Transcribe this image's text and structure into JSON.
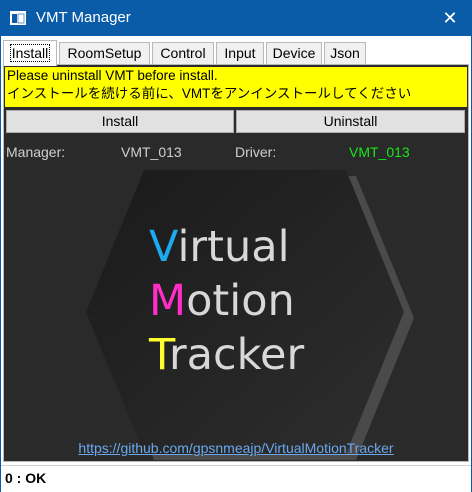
{
  "window": {
    "title": "VMT Manager",
    "close_glyph": "✕"
  },
  "tabs": [
    {
      "label": "Install"
    },
    {
      "label": "RoomSetup"
    },
    {
      "label": "Control"
    },
    {
      "label": "Input"
    },
    {
      "label": "Device"
    },
    {
      "label": "Json"
    }
  ],
  "install": {
    "warning_line1": "Please uninstall VMT before install.",
    "warning_line2": "インストールを続ける前に、VMTをアンインストールしてください",
    "install_button": "Install",
    "uninstall_button": "Uninstall",
    "manager_label": "Manager:",
    "manager_version": "VMT_013",
    "driver_label": "Driver:",
    "driver_version": "VMT_013",
    "logo": {
      "line1_initial": "V",
      "line1_rest": "irtual",
      "line2_initial": "M",
      "line2_rest": "otion",
      "line3_initial": "T",
      "line3_rest": "racker",
      "colors": {
        "v": "#1eaaf0",
        "m": "#ff2ec8",
        "t": "#ffff30",
        "text": "#d8d8d8"
      }
    },
    "link": "https://github.com/gpsnmeajp/VirtualMotionTracker"
  },
  "status": {
    "text": "0 : OK"
  },
  "colors": {
    "titlebar": "#0a5ca8",
    "warning": "#ffff00",
    "driver_ok": "#17e717"
  }
}
